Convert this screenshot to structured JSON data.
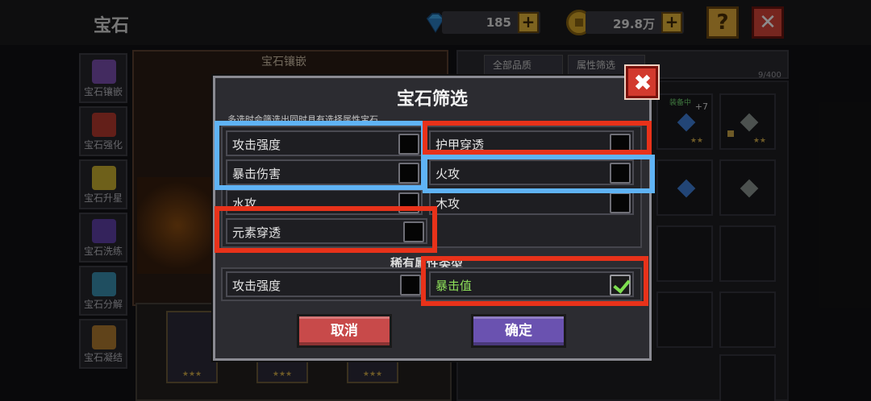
{
  "header": {
    "title": "宝石",
    "gems_value": "185",
    "coins_value": "29.8万",
    "help_label": "?",
    "close_label": "✕"
  },
  "side_nav": [
    {
      "label": "宝石镶嵌",
      "icon": "inlay-gem-icon",
      "color": "#7a4fb0"
    },
    {
      "label": "宝石强化",
      "icon": "enhance-gem-icon",
      "color": "#b43a2e"
    },
    {
      "label": "宝石升星",
      "icon": "star-up-icon",
      "color": "#c9b030"
    },
    {
      "label": "宝石洗练",
      "icon": "refine-gem-icon",
      "color": "#6040a8"
    },
    {
      "label": "宝石分解",
      "icon": "decompose-gem-icon",
      "color": "#3a8fb0"
    },
    {
      "label": "宝石凝结",
      "icon": "condense-gem-icon",
      "color": "#b07a30"
    }
  ],
  "inlay": {
    "title": "宝石镶嵌"
  },
  "gem_list": {
    "filter_quality": "全部品质",
    "filter_attr": "属性筛选",
    "count": "9/400",
    "equipped_badge": "装备中",
    "plus_level": "+7",
    "stars": "★★"
  },
  "bottom_slots": {
    "stars": "★★★"
  },
  "modal": {
    "title": "宝石筛选",
    "hint": "多选时会筛选出同时具有选择属性宝石",
    "options": {
      "attack_strength": "攻击强度",
      "armor_penetration": "护甲穿透",
      "crit_damage": "暴击伤害",
      "fire_attack": "火攻",
      "water_attack": "水攻",
      "wood_attack": "木攻",
      "element_penetration": "元素穿透"
    },
    "section2_title": "稀有属性类型",
    "options2": {
      "attack_strength": "攻击强度",
      "crit_value": "暴击值"
    },
    "cancel_label": "取消",
    "confirm_label": "确定"
  },
  "colors": {
    "highlight_blue": "#5fb3f5",
    "highlight_red": "#e8321a",
    "checked_green": "#7ddf4f"
  }
}
